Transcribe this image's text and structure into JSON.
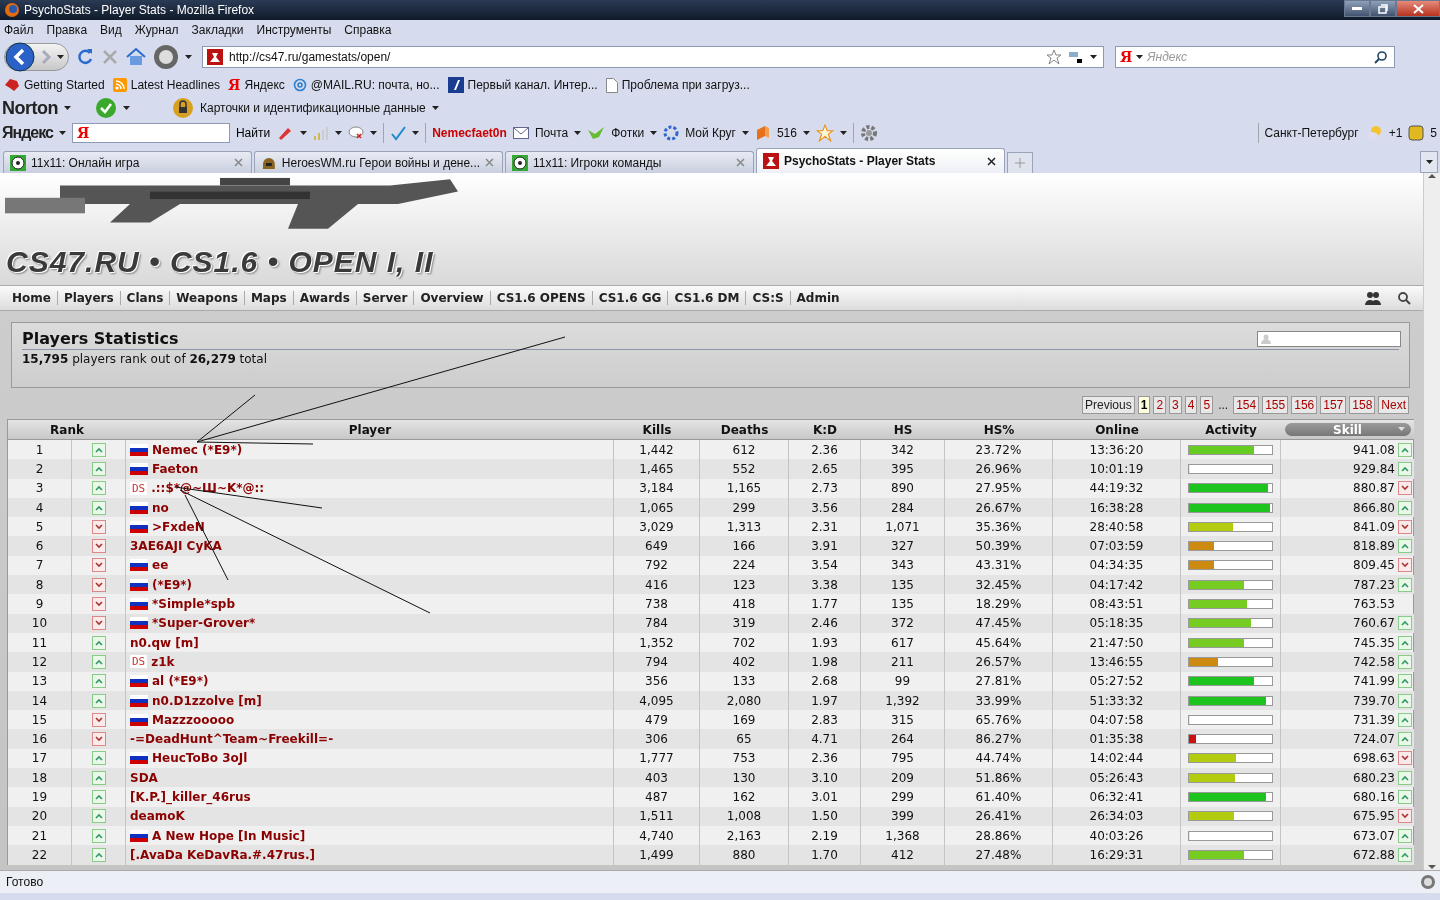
{
  "window": {
    "title": "PsychoStats - Player Stats - Mozilla Firefox"
  },
  "menu": [
    "Файл",
    "Правка",
    "Вид",
    "Журнал",
    "Закладки",
    "Инструменты",
    "Справка"
  ],
  "address": {
    "url": "http://cs47.ru/gamestats/open/"
  },
  "search": {
    "engine": "Я",
    "placeholder": "Яндекс"
  },
  "bookmarks": [
    {
      "kind": "red",
      "label": "Getting Started"
    },
    {
      "kind": "rss",
      "label": "Latest Headlines"
    },
    {
      "kind": "letter",
      "icon_text": "Я",
      "label": "Яндекс"
    },
    {
      "kind": "at",
      "label": "@MAIL.RU: почта, но..."
    },
    {
      "kind": "channel",
      "label": "Первый канал. Интер..."
    },
    {
      "kind": "page",
      "label": "Проблема при загруз..."
    }
  ],
  "norton": {
    "logo": "Norton",
    "identity": "Карточки и идентификационные данные"
  },
  "yandex_bar": {
    "logo": "Яндекс",
    "field_icon": "Я",
    "find": "Найти",
    "user": "Nemecfaet0n",
    "mail": "Почта",
    "photos": "Фотки",
    "circle": "Мой Круг",
    "count": "516",
    "city": "Санкт-Петербург",
    "temperature": "+1",
    "badge": "5"
  },
  "tabs": [
    {
      "label": "11x11: Онлайн игра",
      "selected": false
    },
    {
      "label": "HeroesWM.ru Герои войны и дене...",
      "selected": false
    },
    {
      "label": "11x11: Игроки команды",
      "selected": false
    },
    {
      "label": "PsychoStats - Player Stats",
      "selected": true
    }
  ],
  "site": {
    "logo": "CS47.RU • CS1.6 • OPEN I, II",
    "nav": [
      "Home",
      "Players",
      "Clans",
      "Weapons",
      "Maps",
      "Awards",
      "Server",
      "Overview",
      "CS1.6 OPENS",
      "CS1.6 GG",
      "CS1.6 DM",
      "CS:S",
      "Admin"
    ]
  },
  "panel": {
    "title": "Players Statistics",
    "summary": "**15,795** players rank out of **26,279** total"
  },
  "pagination": {
    "previous": "Previous",
    "pages": [
      {
        "label": "1",
        "selected": true,
        "kind": "page"
      },
      {
        "label": "2",
        "selected": false,
        "kind": "page"
      },
      {
        "label": "3",
        "selected": false,
        "kind": "page"
      },
      {
        "label": "4",
        "selected": false,
        "kind": "page"
      },
      {
        "label": "5",
        "selected": false,
        "kind": "page"
      },
      {
        "label": "...",
        "kind": "ellipsis"
      },
      {
        "label": "154",
        "selected": false,
        "kind": "page"
      },
      {
        "label": "155",
        "selected": false,
        "kind": "page"
      },
      {
        "label": "156",
        "selected": false,
        "kind": "page"
      },
      {
        "label": "157",
        "selected": false,
        "kind": "page"
      },
      {
        "label": "158",
        "selected": false,
        "kind": "page"
      }
    ],
    "next": "Next"
  },
  "table": {
    "columns": [
      {
        "label": "Rank",
        "sorted": false
      },
      {
        "label": "Player",
        "sorted": false
      },
      {
        "label": "Kills",
        "sorted": false
      },
      {
        "label": "Deaths",
        "sorted": false
      },
      {
        "label": "K:D",
        "sorted": false
      },
      {
        "label": "HS",
        "sorted": false
      },
      {
        "label": "HS%",
        "sorted": false
      },
      {
        "label": "Online",
        "sorted": false
      },
      {
        "label": "Activity",
        "sorted": false
      },
      {
        "label": "Skill",
        "sorted": true
      }
    ],
    "rows": [
      {
        "rank": "1",
        "rank_up": true,
        "flag": {
          "kind": "ru"
        },
        "name": "Nemec (*E9*)",
        "kills": "1,442",
        "deaths": "612",
        "kd": "2.36",
        "hs": "342",
        "hs_pct": "23.72%",
        "online": "13:36:20",
        "level": 0.78,
        "color": "#66cc22",
        "skill": "941.08",
        "skill_up": true,
        "skill_changed": true
      },
      {
        "rank": "2",
        "rank_up": true,
        "flag": {
          "kind": "ru"
        },
        "name": "Faeton",
        "kills": "1,465",
        "deaths": "552",
        "kd": "2.65",
        "hs": "395",
        "hs_pct": "26.96%",
        "online": "10:01:19",
        "level": 0,
        "skill": "929.84",
        "skill_up": true,
        "skill_changed": true
      },
      {
        "rank": "3",
        "rank_up": true,
        "flag": {
          "kind": "text",
          "text": "DS"
        },
        "name": ".::$*@~Ш~K*@::",
        "kills": "3,184",
        "deaths": "1,165",
        "kd": "2.73",
        "hs": "890",
        "hs_pct": "27.95%",
        "online": "44:19:32",
        "level": 0.95,
        "color": "#1ec41e",
        "skill": "880.87",
        "skill_up": false,
        "skill_changed": true
      },
      {
        "rank": "4",
        "rank_up": true,
        "flag": {
          "kind": "ru"
        },
        "name": "no",
        "kills": "1,065",
        "deaths": "299",
        "kd": "3.56",
        "hs": "284",
        "hs_pct": "26.67%",
        "online": "16:38:28",
        "level": 0.98,
        "color": "#1ec41e",
        "skill": "866.80",
        "skill_up": true,
        "skill_changed": true
      },
      {
        "rank": "5",
        "rank_up": false,
        "flag": {
          "kind": "ru"
        },
        "name": ">FxdeN",
        "kills": "3,029",
        "deaths": "1,313",
        "kd": "2.31",
        "hs": "1,071",
        "hs_pct": "35.36%",
        "online": "28:40:58",
        "level": 0.53,
        "color": "#b4cc10",
        "skill": "841.09",
        "skill_up": false,
        "skill_changed": true
      },
      {
        "rank": "6",
        "rank_up": false,
        "name": "3AE6AJI CyKA",
        "kills": "649",
        "deaths": "166",
        "kd": "3.91",
        "hs": "327",
        "hs_pct": "50.39%",
        "online": "07:03:59",
        "level": 0.3,
        "color": "#cc8a10",
        "skill": "818.89",
        "skill_up": true,
        "skill_changed": true
      },
      {
        "rank": "7",
        "rank_up": false,
        "flag": {
          "kind": "ru"
        },
        "name": "ee",
        "kills": "792",
        "deaths": "224",
        "kd": "3.54",
        "hs": "343",
        "hs_pct": "43.31%",
        "online": "04:34:35",
        "level": 0.3,
        "color": "#cc8a10",
        "skill": "809.45",
        "skill_up": false,
        "skill_changed": true
      },
      {
        "rank": "8",
        "rank_up": false,
        "flag": {
          "kind": "ru"
        },
        "name": "(*E9*)",
        "kills": "416",
        "deaths": "123",
        "kd": "3.38",
        "hs": "135",
        "hs_pct": "32.45%",
        "online": "04:17:42",
        "level": 0.66,
        "color": "#77cc22",
        "skill": "787.23",
        "skill_up": true,
        "skill_changed": true
      },
      {
        "rank": "9",
        "rank_up": false,
        "flag": {
          "kind": "ru"
        },
        "name": "*Simple*spb",
        "kills": "738",
        "deaths": "418",
        "kd": "1.77",
        "hs": "135",
        "hs_pct": "18.29%",
        "online": "08:43:51",
        "level": 0.7,
        "color": "#77cc22",
        "skill": "763.53",
        "skill_changed": false
      },
      {
        "rank": "10",
        "rank_up": false,
        "flag": {
          "kind": "ru"
        },
        "name": "*Super-Grover*",
        "kills": "784",
        "deaths": "319",
        "kd": "2.46",
        "hs": "372",
        "hs_pct": "47.45%",
        "online": "05:18:35",
        "level": 0.75,
        "color": "#77cc22",
        "skill": "760.67",
        "skill_up": true,
        "skill_changed": true
      },
      {
        "rank": "11",
        "rank_up": true,
        "name": "n0.qw [m]",
        "kills": "1,352",
        "deaths": "702",
        "kd": "1.93",
        "hs": "617",
        "hs_pct": "45.64%",
        "online": "21:47:50",
        "level": 0.66,
        "color": "#77cc22",
        "skill": "745.35",
        "skill_up": true,
        "skill_changed": true
      },
      {
        "rank": "12",
        "rank_up": true,
        "flag": {
          "kind": "text",
          "text": "DS"
        },
        "name": "z1k",
        "kills": "794",
        "deaths": "402",
        "kd": "1.98",
        "hs": "211",
        "hs_pct": "26.57%",
        "online": "13:46:55",
        "level": 0.35,
        "color": "#cc8a10",
        "skill": "742.58",
        "skill_up": true,
        "skill_changed": true
      },
      {
        "rank": "13",
        "rank_up": true,
        "flag": {
          "kind": "ru"
        },
        "name": "al (*E9*)",
        "kills": "356",
        "deaths": "133",
        "kd": "2.68",
        "hs": "99",
        "hs_pct": "27.81%",
        "online": "05:27:52",
        "level": 0.78,
        "color": "#1ec41e",
        "skill": "741.99",
        "skill_up": true,
        "skill_changed": true
      },
      {
        "rank": "14",
        "rank_up": true,
        "flag": {
          "kind": "ru"
        },
        "name": "n0.D1zzolve [m]",
        "kills": "4,095",
        "deaths": "2,080",
        "kd": "1.97",
        "hs": "1,392",
        "hs_pct": "33.99%",
        "online": "51:33:32",
        "level": 0.93,
        "color": "#1ec41e",
        "skill": "739.70",
        "skill_up": true,
        "skill_changed": true
      },
      {
        "rank": "15",
        "rank_up": false,
        "flag": {
          "kind": "ru"
        },
        "name": "Mazzzooooo",
        "kills": "479",
        "deaths": "169",
        "kd": "2.83",
        "hs": "315",
        "hs_pct": "65.76%",
        "online": "04:07:58",
        "level": 0,
        "skill": "731.39",
        "skill_up": true,
        "skill_changed": true
      },
      {
        "rank": "16",
        "rank_up": false,
        "name": "-=DeadHunt^Team~Freekill=-",
        "kills": "306",
        "deaths": "65",
        "kd": "4.71",
        "hs": "264",
        "hs_pct": "86.27%",
        "online": "01:35:38",
        "level": 0.08,
        "color": "#cc1111",
        "skill": "724.07",
        "skill_up": true,
        "skill_changed": true
      },
      {
        "rank": "17",
        "rank_up": true,
        "flag": {
          "kind": "ru"
        },
        "name": "HeucToBo 3oJl",
        "kills": "1,777",
        "deaths": "753",
        "kd": "2.36",
        "hs": "795",
        "hs_pct": "44.74%",
        "online": "14:02:44",
        "level": 0.57,
        "color": "#b4cc10",
        "skill": "698.63",
        "skill_up": false,
        "skill_changed": true
      },
      {
        "rank": "18",
        "rank_up": true,
        "name": "SDA",
        "kills": "403",
        "deaths": "130",
        "kd": "3.10",
        "hs": "209",
        "hs_pct": "51.86%",
        "online": "05:26:43",
        "level": 0.55,
        "color": "#b4cc10",
        "skill": "680.23",
        "skill_up": true,
        "skill_changed": true
      },
      {
        "rank": "19",
        "rank_up": true,
        "name": "[K.P.]_killer_46rus",
        "kills": "487",
        "deaths": "162",
        "kd": "3.01",
        "hs": "299",
        "hs_pct": "61.40%",
        "online": "06:32:41",
        "level": 0.93,
        "color": "#1ec41e",
        "skill": "680.16",
        "skill_up": true,
        "skill_changed": true
      },
      {
        "rank": "20",
        "rank_up": true,
        "name": "deamoK",
        "kills": "1,511",
        "deaths": "1,008",
        "kd": "1.50",
        "hs": "399",
        "hs_pct": "26.41%",
        "online": "26:34:03",
        "level": 0.54,
        "color": "#b4cc10",
        "skill": "675.95",
        "skill_up": false,
        "skill_changed": true
      },
      {
        "rank": "21",
        "rank_up": true,
        "flag": {
          "kind": "ru"
        },
        "name": "A New Hope [In Music]",
        "kills": "4,740",
        "deaths": "2,163",
        "kd": "2.19",
        "hs": "1,368",
        "hs_pct": "28.86%",
        "online": "40:03:26",
        "level": 0,
        "skill": "673.07",
        "skill_up": true,
        "skill_changed": true
      },
      {
        "rank": "22",
        "rank_up": true,
        "name": "[.AvaDa KeDavRa.#.47rus.]",
        "kills": "1,499",
        "deaths": "880",
        "kd": "1.70",
        "hs": "412",
        "hs_pct": "27.48%",
        "online": "16:29:31",
        "level": 0.66,
        "color": "#77cc22",
        "skill": "672.88",
        "skill_up": true,
        "skill_changed": true
      }
    ]
  },
  "status_bar": {
    "text": "Готово"
  }
}
